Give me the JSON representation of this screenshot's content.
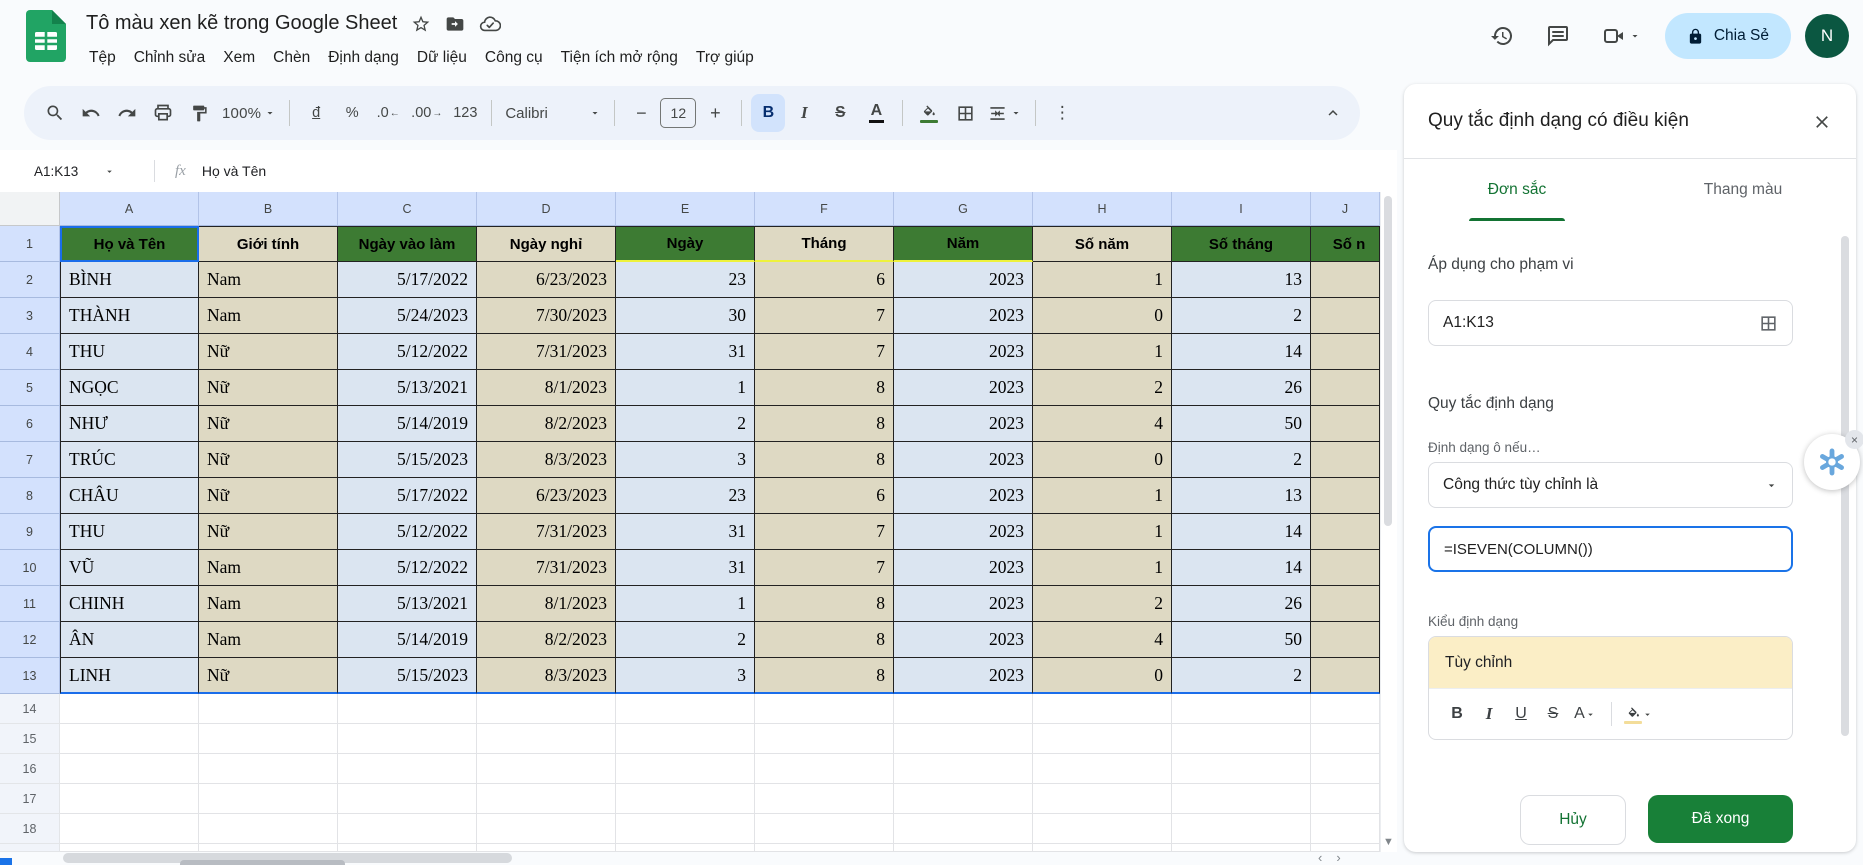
{
  "app": {
    "title": "Tô màu xen kẽ trong Google Sheet",
    "menus": [
      "Tệp",
      "Chỉnh sửa",
      "Xem",
      "Chèn",
      "Định dạng",
      "Dữ liệu",
      "Công cụ",
      "Tiện ích mở rộng",
      "Trợ giúp"
    ],
    "share_label": "Chia Sẻ",
    "avatar_letter": "N"
  },
  "toolbar": {
    "zoom": "100%",
    "currency": "đ",
    "percent": "%",
    "decrease_decimal": ".0",
    "increase_decimal": ".00",
    "more_formats": "123",
    "font_name": "Calibri",
    "minus": "−",
    "font_size": "12",
    "plus": "+",
    "bold": "B",
    "italic": "I",
    "strike": "S",
    "text_color": "A",
    "fill_current_color": "#3d7b33"
  },
  "formula_bar": {
    "name_box": "A1:K13",
    "fx": "fx",
    "value": "Họ và Tên"
  },
  "grid": {
    "columns": [
      {
        "letter": "A",
        "header": "Họ và Tên",
        "header_style": "green",
        "cell_style": "blue",
        "align": "left"
      },
      {
        "letter": "B",
        "header": "Giới tính",
        "header_style": "beige",
        "cell_style": "beige",
        "align": "left"
      },
      {
        "letter": "C",
        "header": "Ngày vào làm",
        "header_style": "green",
        "cell_style": "blue",
        "align": "right"
      },
      {
        "letter": "D",
        "header": "Ngày nghỉ",
        "header_style": "beige",
        "cell_style": "beige",
        "align": "right"
      },
      {
        "letter": "E",
        "header": "Ngày",
        "header_style": "green",
        "cell_style": "blue",
        "align": "right",
        "yellow_underline": true
      },
      {
        "letter": "F",
        "header": "Tháng",
        "header_style": "beige",
        "cell_style": "beige",
        "align": "right",
        "yellow_underline": true
      },
      {
        "letter": "G",
        "header": "Năm",
        "header_style": "green",
        "cell_style": "blue",
        "align": "right",
        "yellow_underline": true
      },
      {
        "letter": "H",
        "header": "Số năm",
        "header_style": "beige",
        "cell_style": "beige",
        "align": "right"
      },
      {
        "letter": "I",
        "header": "Số tháng",
        "header_style": "green",
        "cell_style": "blue",
        "align": "right"
      },
      {
        "letter": "J",
        "header": "Số n",
        "header_style": "green",
        "cell_style": "beige",
        "align": "left"
      }
    ],
    "rows": [
      [
        "BÌNH",
        "Nam",
        "5/17/2022",
        "6/23/2023",
        "23",
        "6",
        "2023",
        "1",
        "13",
        ""
      ],
      [
        "THÀNH",
        "Nam",
        "5/24/2023",
        "7/30/2023",
        "30",
        "7",
        "2023",
        "0",
        "2",
        ""
      ],
      [
        "THU",
        "Nữ",
        "5/12/2022",
        "7/31/2023",
        "31",
        "7",
        "2023",
        "1",
        "14",
        ""
      ],
      [
        "NGỌC",
        "Nữ",
        "5/13/2021",
        "8/1/2023",
        "1",
        "8",
        "2023",
        "2",
        "26",
        ""
      ],
      [
        "NHƯ",
        "Nữ",
        "5/14/2019",
        "8/2/2023",
        "2",
        "8",
        "2023",
        "4",
        "50",
        ""
      ],
      [
        "TRÚC",
        "Nữ",
        "5/15/2023",
        "8/3/2023",
        "3",
        "8",
        "2023",
        "0",
        "2",
        ""
      ],
      [
        "CHÂU",
        "Nữ",
        "5/17/2022",
        "6/23/2023",
        "23",
        "6",
        "2023",
        "1",
        "13",
        ""
      ],
      [
        "THU",
        "Nữ",
        "5/12/2022",
        "7/31/2023",
        "31",
        "7",
        "2023",
        "1",
        "14",
        ""
      ],
      [
        "VŨ",
        "Nam",
        "5/12/2022",
        "7/31/2023",
        "31",
        "7",
        "2023",
        "1",
        "14",
        ""
      ],
      [
        "CHINH",
        "Nam",
        "5/13/2021",
        "8/1/2023",
        "1",
        "8",
        "2023",
        "2",
        "26",
        ""
      ],
      [
        "ÂN",
        "Nam",
        "5/14/2019",
        "8/2/2023",
        "2",
        "8",
        "2023",
        "4",
        "50",
        ""
      ],
      [
        "LINH",
        "Nữ",
        "5/15/2023",
        "8/3/2023",
        "3",
        "8",
        "2023",
        "0",
        "2",
        ""
      ]
    ],
    "first_data_row_number": 2,
    "empty_row_numbers": [
      14,
      15,
      16,
      17,
      18
    ],
    "colors": {
      "header_green": "#3d7b33",
      "custom_beige": "#ded9c3",
      "data_blue": "#dbe5f1",
      "selected_header": "#d3e1fd",
      "selection_blue": "#1a6dea",
      "yellow_line": "#eef23c"
    }
  },
  "panel": {
    "title": "Quy tắc định dạng có điều kiện",
    "tabs": [
      {
        "label": "Đơn sắc",
        "active": true
      },
      {
        "label": "Thang màu",
        "active": false
      }
    ],
    "apply_range_label": "Áp dụng cho phạm vi",
    "range_value": "A1:K13",
    "rules_heading": "Quy tắc định dạng",
    "condition_label": "Định dạng ô nếu…",
    "condition_value": "Công thức tùy chỉnh là",
    "formula_value": "=ISEVEN(COLUMN())",
    "style_label": "Kiểu định dạng",
    "style_preview_text": "Tùy chỉnh",
    "format_buttons": {
      "bold": "B",
      "italic": "I",
      "underline": "U",
      "strike": "S",
      "text_color": "A"
    },
    "cancel_label": "Hủy",
    "done_label": "Đã xong",
    "colors": {
      "accent_green": "#137333",
      "done_green": "#188038",
      "preview_yellow": "#fbeec6",
      "focus_blue": "#1a73e8"
    }
  }
}
